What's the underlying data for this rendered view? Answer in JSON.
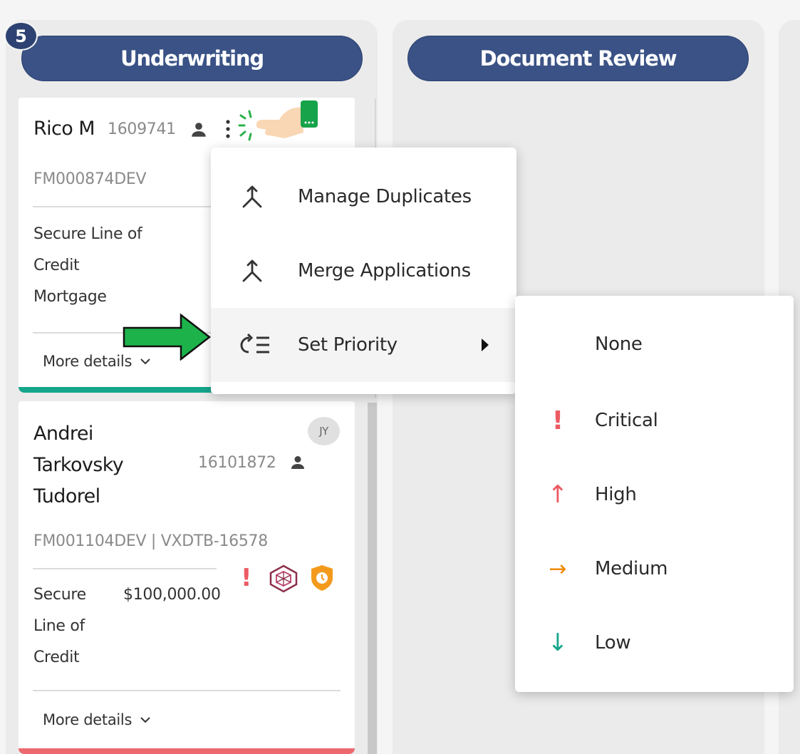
{
  "columns": [
    {
      "title": "Underwriting",
      "count": "5"
    },
    {
      "title": "Document Review"
    }
  ],
  "cards": [
    {
      "name": "Rico M",
      "id": "1609741",
      "reference": "FM000874DEV",
      "product_lines": [
        "Secure Line of",
        "Credit",
        "Mortgage"
      ],
      "more_details": "More details",
      "priority_color": "#15a68c"
    },
    {
      "name_lines": [
        "Andrei",
        "Tarkovsky",
        "Tudorel"
      ],
      "id": "16101872",
      "avatar": "JY",
      "reference": "FM001104DEV | VXDTB-16578",
      "product_lines": [
        "Secure",
        "Line of",
        "Credit"
      ],
      "amount": "$100,000.00",
      "more_details": "More details",
      "priority_color": "#ec6a6f"
    }
  ],
  "context_menu": {
    "items": [
      {
        "label": "Manage Duplicates",
        "icon": "merge-icon"
      },
      {
        "label": "Merge Applications",
        "icon": "merge-icon"
      },
      {
        "label": "Set Priority",
        "icon": "priority-list-icon",
        "has_submenu": true
      }
    ]
  },
  "priority_submenu": {
    "items": [
      {
        "label": "None",
        "icon": ""
      },
      {
        "label": "Critical",
        "icon": "!",
        "color": "#ec5a63"
      },
      {
        "label": "High",
        "icon": "↑",
        "color": "#ec5a63"
      },
      {
        "label": "Medium",
        "icon": "→",
        "color": "#f08a00"
      },
      {
        "label": "Low",
        "icon": "↓",
        "color": "#15a68c"
      }
    ]
  },
  "colors": {
    "header_bg": "#3a5285",
    "badge_bg": "#2d4272",
    "annotation_arrow": "#1db24a"
  }
}
